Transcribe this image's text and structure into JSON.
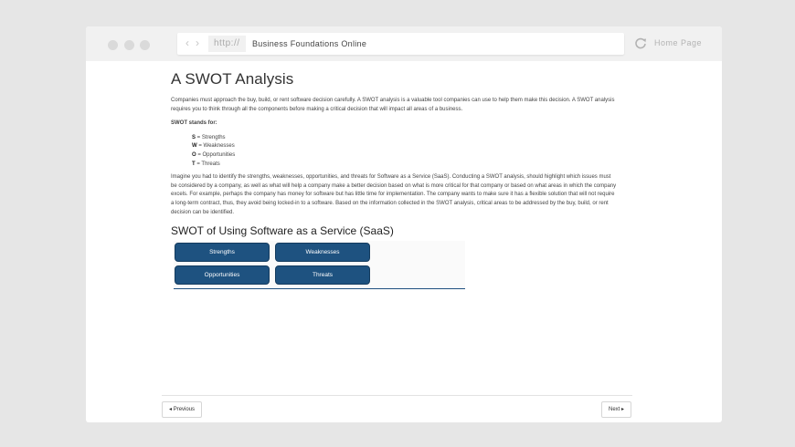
{
  "browser": {
    "protocol": "http://",
    "site_title": "Business Foundations Online",
    "home_label": "Home Page"
  },
  "page": {
    "title": "A SWOT Analysis",
    "intro": "Companies must approach the buy, build, or rent software decision carefully. A SWOT analysis is a valuable tool companies can use to help them make this decision. A SWOT analysis requires you to think through all the components before making a critical decision that will impact all areas of a business.",
    "stands_for_label": "SWOT stands for:",
    "swot_list": [
      {
        "letter": "S",
        "text": " = Strengths"
      },
      {
        "letter": "W",
        "text": " = Weaknesses"
      },
      {
        "letter": "O",
        "text": " = Opportunities"
      },
      {
        "letter": "T",
        "text": " = Threats"
      }
    ],
    "paragraph2": "Imagine you had to identify the strengths, weaknesses, opportunities, and threats for Software as a Service (SaaS). Conducting a SWOT analysis, should highlight which issues must be considered by a company, as well as what will help a company make a better decision based on what is more critical for that company or based on what areas in which the company excels. For example, perhaps the company has money for software but has little time for implementation. The company wants to make sure it has a flexible solution that will not require a long-term contract, thus, they avoid being locked-in to a software. Based on the information collected in the SWOT analysis, critical areas to be addressed by the buy, build, or rent decision can be identified.",
    "section_title": "SWOT of Using Software as a Service (SaaS)",
    "categories": [
      "Strengths",
      "Weaknesses",
      "Opportunities",
      "Threats"
    ]
  },
  "footer": {
    "previous_label": "Previous",
    "next_label": "Next",
    "previous_icon": "caret-left-icon",
    "next_icon": "caret-right-icon"
  },
  "colors": {
    "button_blue": "#1e5280",
    "page_bg": "#e6e6e6"
  }
}
